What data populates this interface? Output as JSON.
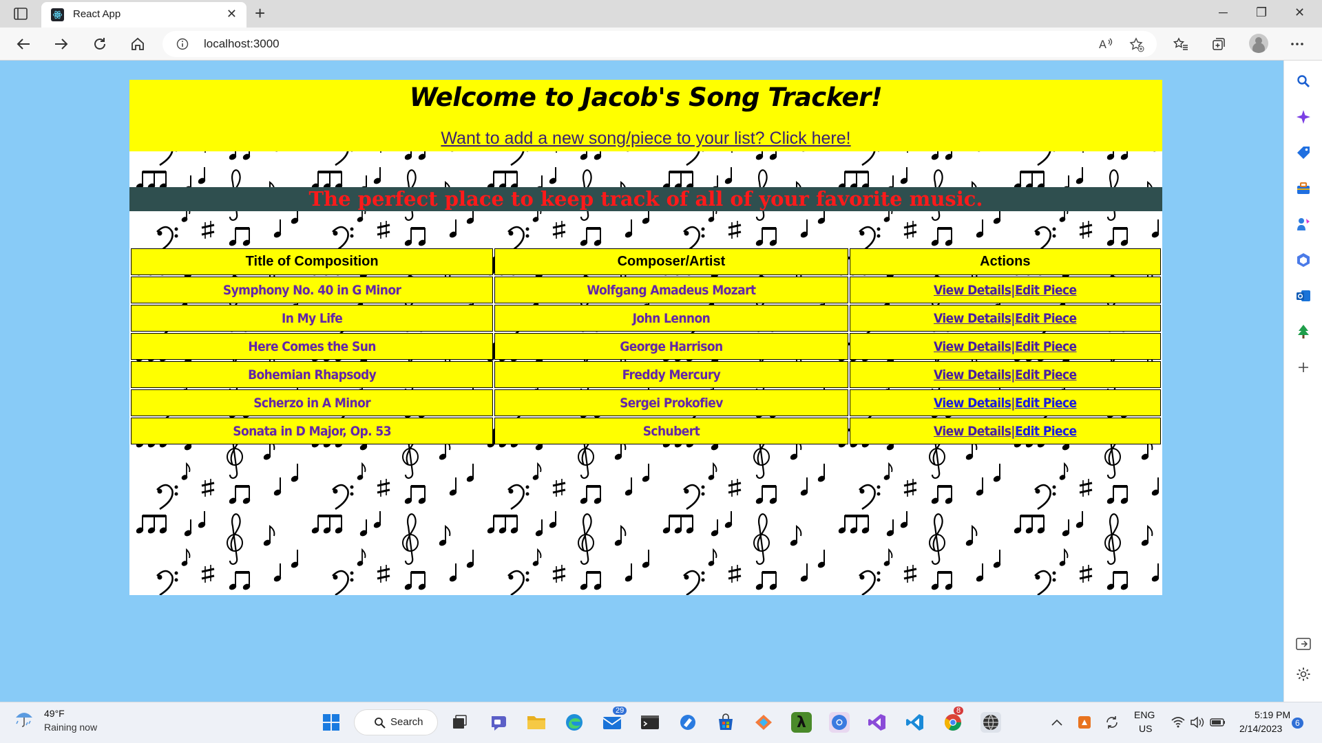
{
  "browser": {
    "tab_title": "React App",
    "url": "localhost:3000"
  },
  "header": {
    "title": "Welcome to Jacob's Song Tracker!",
    "add_link": "Want to add a new song/piece to your list? Click here!",
    "tagline": "The perfect place to keep track of all of your favorite music."
  },
  "table": {
    "headers": [
      "Title of Composition",
      "Composer/Artist",
      "Actions"
    ],
    "rows": [
      {
        "title": "Symphony No. 40 in G Minor",
        "composer": "Wolfgang Amadeus Mozart"
      },
      {
        "title": "In My Life",
        "composer": "John Lennon"
      },
      {
        "title": "Here Comes the Sun",
        "composer": "George Harrison"
      },
      {
        "title": "Bohemian Rhapsody",
        "composer": "Freddy Mercury"
      },
      {
        "title": "Scherzo in A Minor",
        "composer": "Sergei Prokofiev"
      },
      {
        "title": "Sonata in D Major, Op. 53",
        "composer": "Schubert"
      }
    ],
    "view_label": "View Details",
    "separator": "|",
    "edit_label": "Edit Piece"
  },
  "taskbar": {
    "temperature": "49°F",
    "weather": "Raining now",
    "search_label": "Search",
    "mail_badge": "29",
    "chrome_badge": "8",
    "language": "ENG",
    "region": "US",
    "time": "5:19 PM",
    "date": "2/14/2023",
    "notification_count": "6"
  },
  "colors": {
    "page_bg": "#88cbf7",
    "header_bg": "#ffff00",
    "tagline_bar": "#2f4f4f",
    "tagline_text": "#ff1a1a",
    "cell_text": "#6326a8"
  }
}
